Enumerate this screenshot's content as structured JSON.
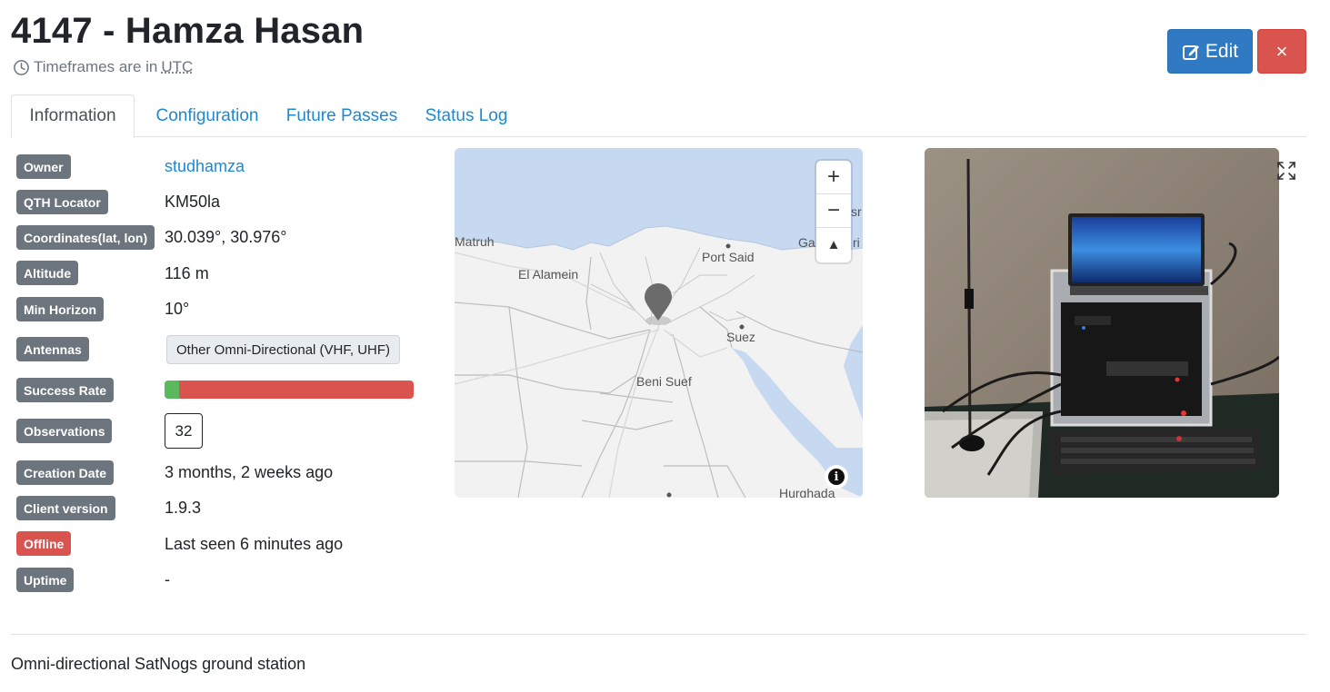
{
  "header": {
    "title": "4147 - Hamza Hasan",
    "timezone_prefix": "Timeframes are in",
    "timezone": "UTC",
    "edit_label": "Edit",
    "delete_label": "×"
  },
  "tabs": [
    {
      "label": "Information",
      "active": true
    },
    {
      "label": "Configuration",
      "active": false
    },
    {
      "label": "Future Passes",
      "active": false
    },
    {
      "label": "Status Log",
      "active": false
    }
  ],
  "info": {
    "owner_label": "Owner",
    "owner": "studhamza",
    "qth_label": "QTH Locator",
    "qth": "KM50la",
    "coords_label": "Coordinates(lat, lon)",
    "coords": "30.039°, 30.976°",
    "altitude_label": "Altitude",
    "altitude": "116 m",
    "horizon_label": "Min Horizon",
    "horizon": "10°",
    "antennas_label": "Antennas",
    "antenna": "Other Omni-Directional (VHF, UHF)",
    "success_label": "Success Rate",
    "success_fraction": 0.06,
    "observations_label": "Observations",
    "observations": "32",
    "creation_label": "Creation Date",
    "creation": "3 months, 2 weeks ago",
    "client_label": "Client version",
    "client": "1.9.3",
    "status_label": "Offline",
    "status": "Last seen 6 minutes ago",
    "uptime_label": "Uptime",
    "uptime": "-"
  },
  "map": {
    "zoom_in": "+",
    "zoom_out": "−",
    "compass": "▲",
    "info": "i",
    "places": {
      "matruh": "Matruh",
      "el_alamein": "El Alamein",
      "port_said": "Port Said",
      "suez": "Suez",
      "beni_suef": "Beni Suef",
      "hurghada": "Hurghada",
      "gaza_partial": "Ga",
      "israel_partial": "sr",
      "israel_partial2": "ri"
    },
    "colors": {
      "sea": "#c6d9f1",
      "land": "#f2f2f2",
      "marker": "#6b6b6b"
    }
  },
  "description": "Omni-directional SatNogs ground station",
  "colors": {
    "primary": "#2f7ac3",
    "danger": "#d9534f",
    "success": "#5cb85c",
    "link": "#1e88d3",
    "badge": "#6c757d"
  }
}
